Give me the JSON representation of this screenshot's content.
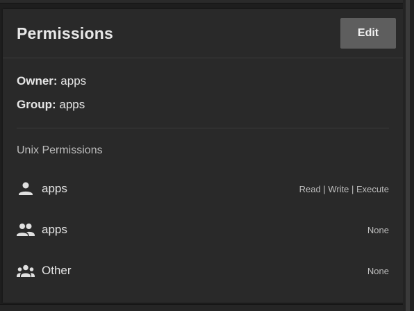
{
  "card": {
    "title": "Permissions",
    "edit_label": "Edit",
    "owner_key": "Owner:",
    "owner_value": "apps",
    "group_key": "Group:",
    "group_value": "apps",
    "section_label": "Unix Permissions"
  },
  "rows": [
    {
      "icon": "person-icon",
      "name": "apps",
      "value": "Read | Write | Execute"
    },
    {
      "icon": "people-icon",
      "name": "apps",
      "value": "None"
    },
    {
      "icon": "groups-icon",
      "name": "Other",
      "value": "None"
    }
  ],
  "colors": {
    "background": "#1e1e1e",
    "card": "#292929",
    "button": "#5e5e5e",
    "text": "#e6e6e6",
    "muted": "#bdbdbd",
    "divider": "#3a3a3a"
  }
}
